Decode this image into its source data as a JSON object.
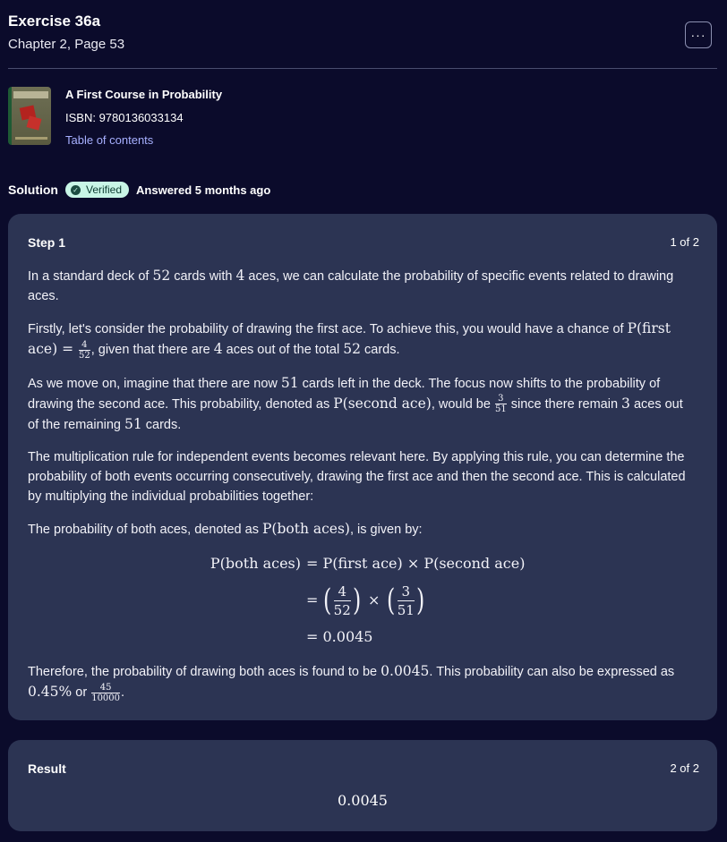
{
  "header": {
    "title": "Exercise 36a",
    "subtitle": "Chapter 2, Page 53",
    "more_label": "···"
  },
  "book": {
    "title": "A First Course in Probability",
    "isbn": "ISBN: 9780136033134",
    "toc_link": "Table of contents"
  },
  "solution": {
    "label": "Solution",
    "badge": "Verified",
    "answered": "Answered 5 months ago"
  },
  "step": {
    "heading": "Step 1",
    "count": "1 of 2",
    "p1a": "In a standard deck of ",
    "p1_n52": "52",
    "p1b": " cards with ",
    "p1_n4": "4",
    "p1c": " aces, we can calculate the probability of specific events related to drawing aces.",
    "p2a": "Firstly, let's consider the probability of drawing the first ace. To achieve this, you would have a chance of ",
    "p2_math": "P(first ace) = ",
    "p2_num": "4",
    "p2_den": "52",
    "p2b": ", given that there are ",
    "p2_n4": "4",
    "p2c": " aces out of the total ",
    "p2_n52": "52",
    "p2d": " cards.",
    "p3a": "As we move on, imagine that there are now ",
    "p3_n51": "51",
    "p3b": " cards left in the deck. The focus now shifts to the probability of drawing the second ace. This probability, denoted as ",
    "p3_math": "P(second ace)",
    "p3c": ", would be ",
    "p3_num": "3",
    "p3_den": "51",
    "p3d": " since there remain ",
    "p3_n3": "3",
    "p3e": " aces out of the remaining ",
    "p3_n51b": "51",
    "p3f": " cards.",
    "p4": "The multiplication rule for independent events becomes relevant here. By applying this rule, you can determine the probability of both events occurring consecutively, drawing the first ace and then the second ace. This is calculated by multiplying the individual probabilities together:",
    "p5a": "The probability of both aces, denoted as ",
    "p5_math": "P(both aces)",
    "p5b": ", is given by:",
    "eq1_lhs": "P(both aces)",
    "eq1_rhs": "= P(first ace) × P(second ace)",
    "eq2_eq": "=",
    "eq2_f1_num": "4",
    "eq2_f1_den": "52",
    "eq2_times": "×",
    "eq2_f2_num": "3",
    "eq2_f2_den": "51",
    "eq3": "= 0.0045",
    "p6a": "Therefore, the probability of drawing both aces is found to be ",
    "p6_val": "0.0045",
    "p6b": ". This probability can also be expressed as ",
    "p6_pct": "0.45%",
    "p6c": " or ",
    "p6_num": "45",
    "p6_den": "10000",
    "p6d": "."
  },
  "result": {
    "heading": "Result",
    "count": "2 of 2",
    "value": "0.0045"
  }
}
